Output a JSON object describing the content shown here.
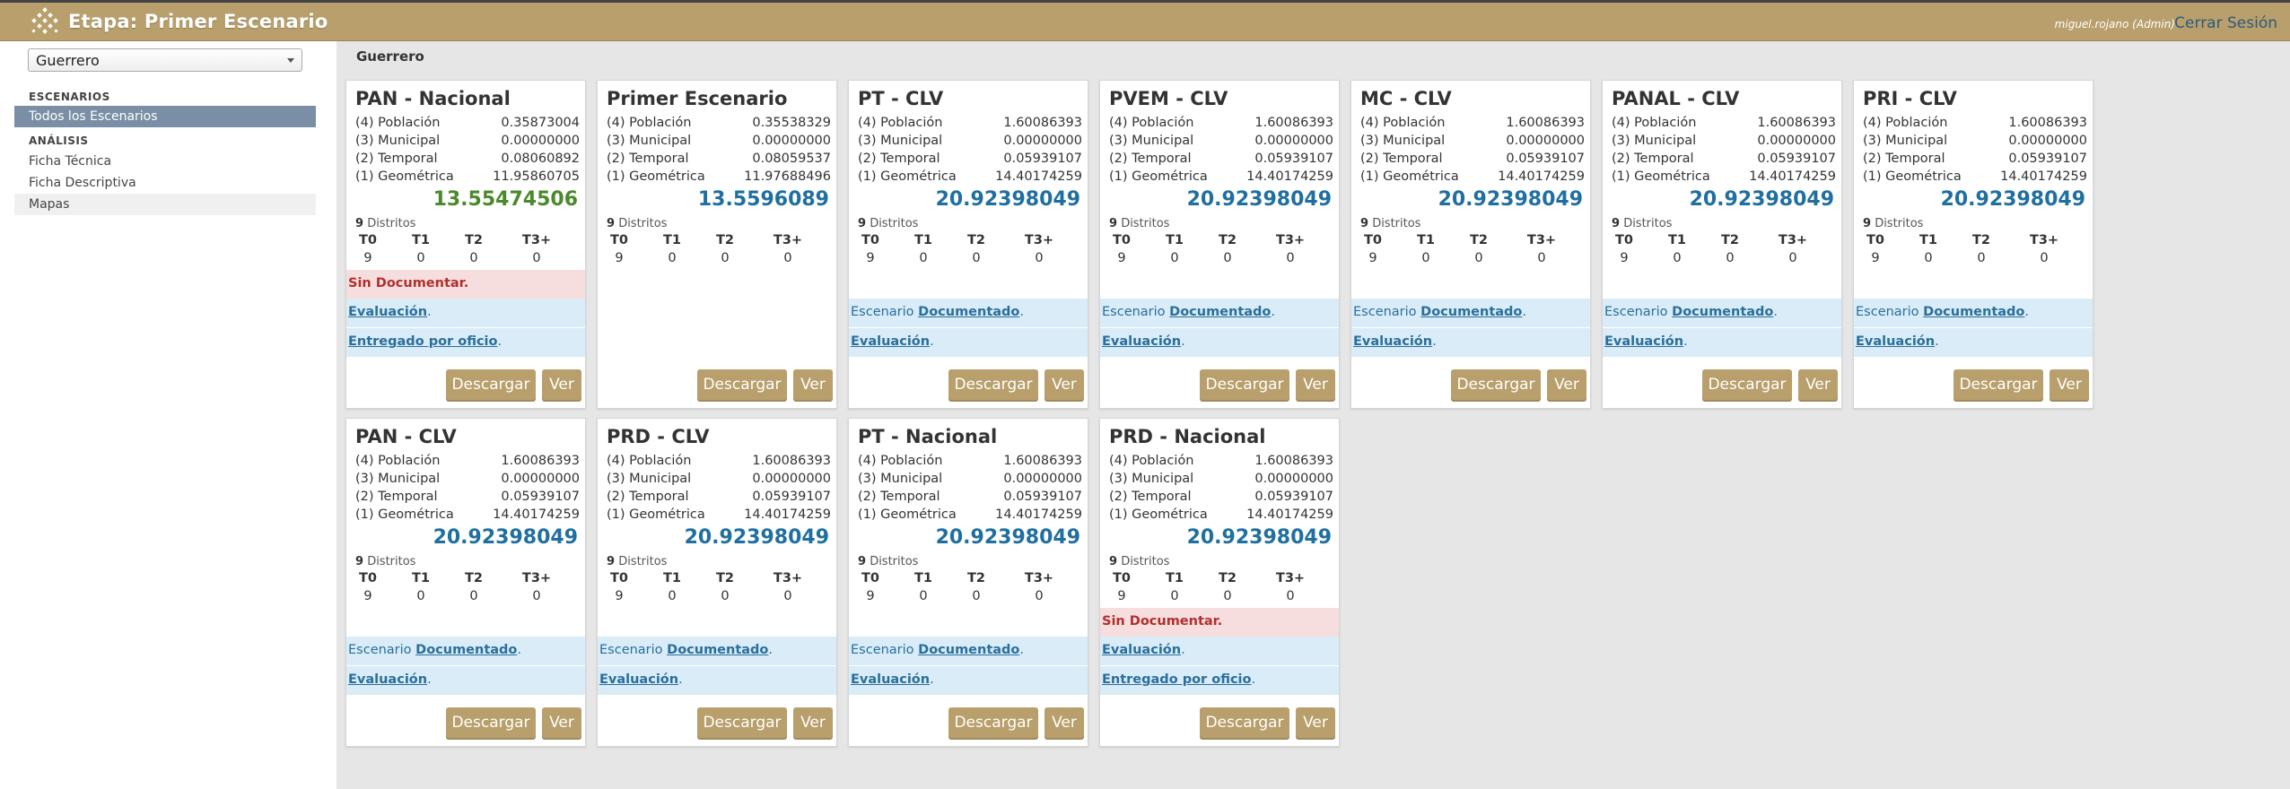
{
  "header": {
    "title": "Etapa: Primer Escenario",
    "user": "miguel.rojano (Admin)",
    "logout": "Cerrar Sesión",
    "logo_icon": "lattice-logo-icon"
  },
  "sidebar": {
    "state_selected": "Guerrero",
    "section_scenarios": "ESCENARIOS",
    "all_scenarios": "Todos los Escenarios",
    "section_analysis": "ANÁLISIS",
    "items": [
      "Ficha Técnica",
      "Ficha Descriptiva",
      "Mapas"
    ]
  },
  "breadcrumb": "Guerrero",
  "labels": {
    "metric_labels": [
      "(4) Población",
      "(3) Municipal",
      "(2) Temporal",
      "(1) Geométrica"
    ],
    "districts_word": "Distritos",
    "tiers": [
      "T0",
      "T1",
      "T2",
      "T3+"
    ],
    "sin_doc": "Sin Documentar.",
    "escenario": "Escenario",
    "documentado": "Documentado",
    "evaluacion": "Evaluación",
    "entregado": "Entregado por oficio",
    "descargar": "Descargar",
    "ver": "Ver"
  },
  "colors": {
    "accent": "#b89f6c",
    "total_green": "#4a8a2a",
    "total_blue": "#1f6fa0"
  },
  "cards": [
    {
      "title": "PAN - Nacional",
      "values": [
        "0.35873004",
        "0.00000000",
        "0.08060892",
        "11.95860705"
      ],
      "total": "13.55474506",
      "total_color": "green",
      "districts": "9",
      "tiers": [
        "9",
        "0",
        "0",
        "0"
      ],
      "status": "sin_doc"
    },
    {
      "title": "Primer Escenario",
      "values": [
        "0.35538329",
        "0.00000000",
        "0.08059537",
        "11.97688496"
      ],
      "total": "13.5596089",
      "total_color": "blue",
      "districts": "9",
      "tiers": [
        "9",
        "0",
        "0",
        "0"
      ],
      "status": "none"
    },
    {
      "title": "PT - CLV",
      "values": [
        "1.60086393",
        "0.00000000",
        "0.05939107",
        "14.40174259"
      ],
      "total": "20.92398049",
      "total_color": "blue",
      "districts": "9",
      "tiers": [
        "9",
        "0",
        "0",
        "0"
      ],
      "status": "doc"
    },
    {
      "title": "PVEM - CLV",
      "values": [
        "1.60086393",
        "0.00000000",
        "0.05939107",
        "14.40174259"
      ],
      "total": "20.92398049",
      "total_color": "blue",
      "districts": "9",
      "tiers": [
        "9",
        "0",
        "0",
        "0"
      ],
      "status": "doc"
    },
    {
      "title": "MC - CLV",
      "values": [
        "1.60086393",
        "0.00000000",
        "0.05939107",
        "14.40174259"
      ],
      "total": "20.92398049",
      "total_color": "blue",
      "districts": "9",
      "tiers": [
        "9",
        "0",
        "0",
        "0"
      ],
      "status": "doc"
    },
    {
      "title": "PANAL - CLV",
      "values": [
        "1.60086393",
        "0.00000000",
        "0.05939107",
        "14.40174259"
      ],
      "total": "20.92398049",
      "total_color": "blue",
      "districts": "9",
      "tiers": [
        "9",
        "0",
        "0",
        "0"
      ],
      "status": "doc"
    },
    {
      "title": "PRI - CLV",
      "values": [
        "1.60086393",
        "0.00000000",
        "0.05939107",
        "14.40174259"
      ],
      "total": "20.92398049",
      "total_color": "blue",
      "districts": "9",
      "tiers": [
        "9",
        "0",
        "0",
        "0"
      ],
      "status": "doc"
    },
    {
      "title": "PAN - CLV",
      "values": [
        "1.60086393",
        "0.00000000",
        "0.05939107",
        "14.40174259"
      ],
      "total": "20.92398049",
      "total_color": "blue",
      "districts": "9",
      "tiers": [
        "9",
        "0",
        "0",
        "0"
      ],
      "status": "doc"
    },
    {
      "title": "PRD - CLV",
      "values": [
        "1.60086393",
        "0.00000000",
        "0.05939107",
        "14.40174259"
      ],
      "total": "20.92398049",
      "total_color": "blue",
      "districts": "9",
      "tiers": [
        "9",
        "0",
        "0",
        "0"
      ],
      "status": "doc"
    },
    {
      "title": "PT - Nacional",
      "values": [
        "1.60086393",
        "0.00000000",
        "0.05939107",
        "14.40174259"
      ],
      "total": "20.92398049",
      "total_color": "blue",
      "districts": "9",
      "tiers": [
        "9",
        "0",
        "0",
        "0"
      ],
      "status": "doc"
    },
    {
      "title": "PRD - Nacional",
      "values": [
        "1.60086393",
        "0.00000000",
        "0.05939107",
        "14.40174259"
      ],
      "total": "20.92398049",
      "total_color": "blue",
      "districts": "9",
      "tiers": [
        "9",
        "0",
        "0",
        "0"
      ],
      "status": "sin_doc"
    }
  ]
}
